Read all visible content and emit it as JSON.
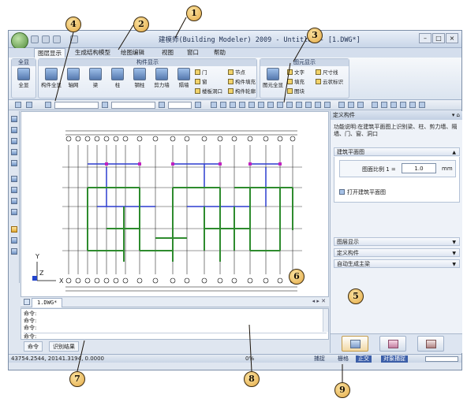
{
  "app": {
    "title": "建模师(Building Modeler) 2009 - Untitled - [1.DWG*]",
    "quick_access": [
      "save-icon",
      "new-icon",
      "open-icon",
      "print-icon"
    ]
  },
  "menu": {
    "tabs": [
      "图层显示",
      "生成结构模型",
      "绘图编辑",
      "视图",
      "窗口",
      "帮助"
    ],
    "active_tab": "图层显示"
  },
  "ribbon": {
    "groups": [
      {
        "title": "全显",
        "items": [
          "全显"
        ]
      },
      {
        "title": "构件显示",
        "big_items": [
          "构件全显",
          "轴网",
          "梁",
          "柱",
          "钢柱",
          "剪力墙",
          "隔墙"
        ],
        "small_items": [
          "门",
          "窗",
          "楼板洞口",
          "节点",
          "构件填充",
          "构件轮廓"
        ]
      },
      {
        "title": "图元显示",
        "big_items": [
          "图元全显"
        ],
        "small_items": [
          "文字",
          "尺寸线",
          "填充",
          "云状标识",
          "图块"
        ]
      }
    ]
  },
  "document": {
    "tab_label": "1.DWG*",
    "axis_labels": {
      "x": "X",
      "y": "Y",
      "z": "Z"
    }
  },
  "command": {
    "lines": [
      "命令:",
      "命令:",
      "命令:"
    ],
    "input_label": "命令:",
    "tabs": [
      "命令",
      "识别结果"
    ]
  },
  "panel": {
    "title": "定义构件",
    "description": "功能说明:在建筑平面图上识别梁、柱、剪力墙、隔墙、门、窗、洞口",
    "sections": [
      {
        "label": "建筑平面图",
        "expanded": true
      },
      {
        "label": "图层显示",
        "expanded": false
      },
      {
        "label": "定义构件",
        "expanded": false
      },
      {
        "label": "自动生成主梁",
        "expanded": false
      }
    ],
    "scale_label": "图面比例 1 =",
    "scale_value": "1.0",
    "scale_unit": "mm",
    "open_plan_label": "打开建筑平面图"
  },
  "status": {
    "coords": "43754.2544, 20141.3194, 0.0000",
    "center": "0%",
    "snap": "捕捉",
    "toggles": [
      {
        "label": "栅格",
        "on": false
      },
      {
        "label": "正交",
        "on": true
      },
      {
        "label": "对象捕捉",
        "on": true
      }
    ]
  },
  "callouts": [
    "1",
    "2",
    "3",
    "4",
    "5",
    "6",
    "7",
    "8",
    "9"
  ],
  "colors": {
    "axis_grid": "#000000",
    "wall_green": "#2e8b2e",
    "beam_blue": "#2b3ccf",
    "column_magenta": "#c020c0",
    "callout_fill": "#e4a945"
  }
}
